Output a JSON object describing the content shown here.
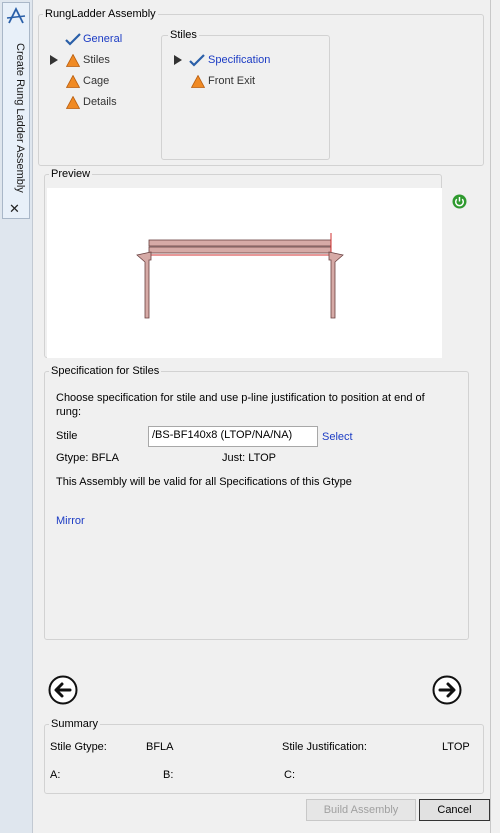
{
  "sidetab": {
    "label": "Create Rung Ladder Assembly",
    "close_glyph": "✕"
  },
  "assembly": {
    "title": "RungLadder Assembly",
    "steps": [
      {
        "label": "General",
        "state": "done",
        "current": false
      },
      {
        "label": "Stiles",
        "state": "warning",
        "current": true
      },
      {
        "label": "Cage",
        "state": "warning",
        "current": false
      },
      {
        "label": "Details",
        "state": "warning",
        "current": false
      }
    ],
    "stiles_group": {
      "title": "Stiles",
      "items": [
        {
          "label": "Specification",
          "state": "done",
          "current": true
        },
        {
          "label": "Front Exit",
          "state": "warning",
          "current": false
        }
      ]
    }
  },
  "preview": {
    "title": "Preview"
  },
  "specification": {
    "title": "Specification for Stiles",
    "instruction": "Choose specification for stile and use p-line justification to position at end of rung:",
    "stile_label": "Stile",
    "stile_value": "/BS-BF140x8 (LTOP/NA/NA)",
    "select_label": "Select",
    "gtype_text": "Gtype: BFLA",
    "just_text": "Just: LTOP",
    "valid_note": "This Assembly will be valid for all Specifications of this Gtype",
    "mirror_label": "Mirror"
  },
  "summary": {
    "title": "Summary",
    "stile_gtype_label": "Stile Gtype:",
    "stile_gtype_value": "BFLA",
    "stile_just_label": "Stile Justification:",
    "stile_just_value": "LTOP",
    "a_label": "A:",
    "b_label": "B:",
    "c_label": "C:"
  },
  "buttons": {
    "build": "Build Assembly",
    "cancel": "Cancel"
  },
  "colors": {
    "warning": "#f08a24",
    "check": "#2a5fa8",
    "link": "#1c3cc4",
    "refresh": "#2f9a2f",
    "ladder": "#c48c8c",
    "pline": "#d03030"
  }
}
